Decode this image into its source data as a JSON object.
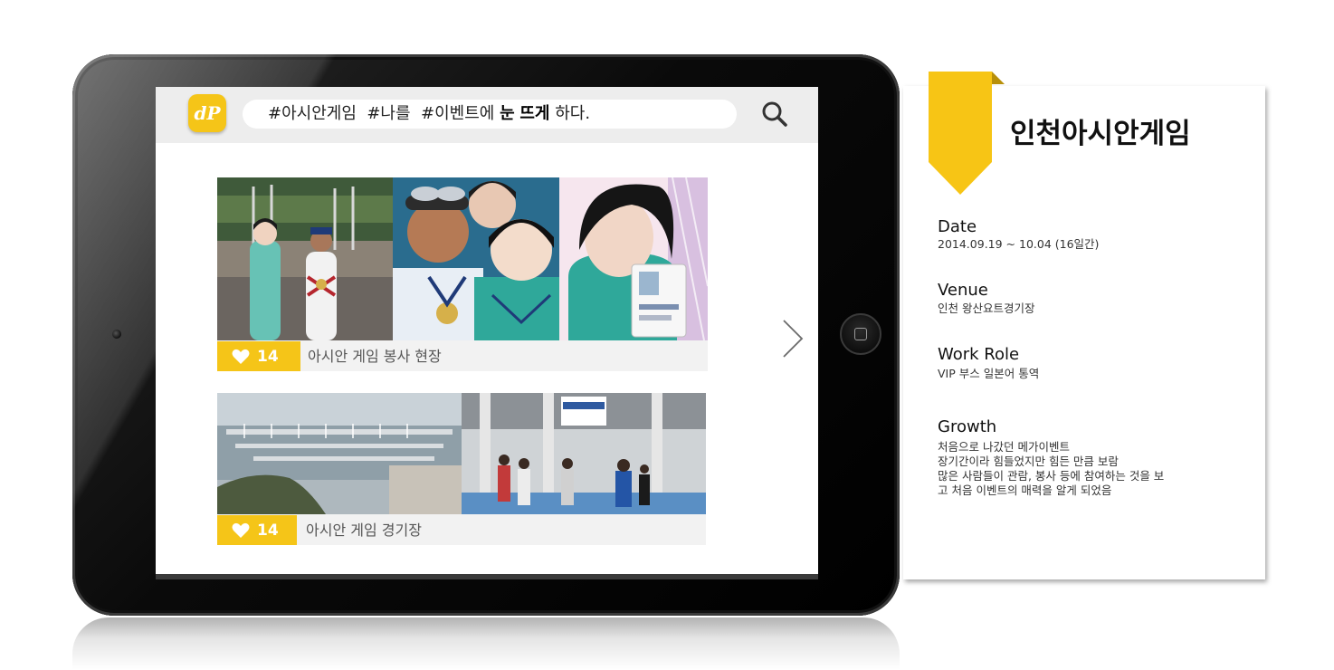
{
  "search_tags": {
    "tag1": "#아시안게임",
    "tag2": "#나를",
    "tag3": "#이벤트에",
    "em1": "눈",
    "em2": "뜨게",
    "tail": "하다."
  },
  "logo_text": "dP",
  "posts": [
    {
      "likes": "14",
      "caption": "아시안 게임 봉사 현장"
    },
    {
      "likes": "14",
      "caption": "아시안 게임 경기장"
    }
  ],
  "panel": {
    "title": "인천아시안게임",
    "sections": [
      {
        "label": "Date",
        "value": "2014.09.19 ~ 10.04 (16일간)"
      },
      {
        "label": "Venue",
        "value": "인천 왕산요트경기장"
      },
      {
        "label": "Work Role",
        "value": "VIP 부스 일본어 통역"
      },
      {
        "label": "Growth",
        "lines": [
          "처음으로 나갔던 메가이벤트",
          "장기간이라 힘들었지만 힘든 만큼 보람",
          "많은 사람들이 관람, 봉사 등에 참여하는 것을 보",
          "고 처음 이벤트의 매력을 알게 되었음"
        ]
      }
    ]
  },
  "colors": {
    "accent_yellow": "#f5c518",
    "ribbon_yellow": "#f7c515",
    "topbar_gray": "#ededed",
    "card_gray": "#f2f2f2"
  },
  "icons": {
    "search": "magnifier",
    "like": "heart",
    "next": "chevron-right",
    "home": "rounded-square"
  }
}
